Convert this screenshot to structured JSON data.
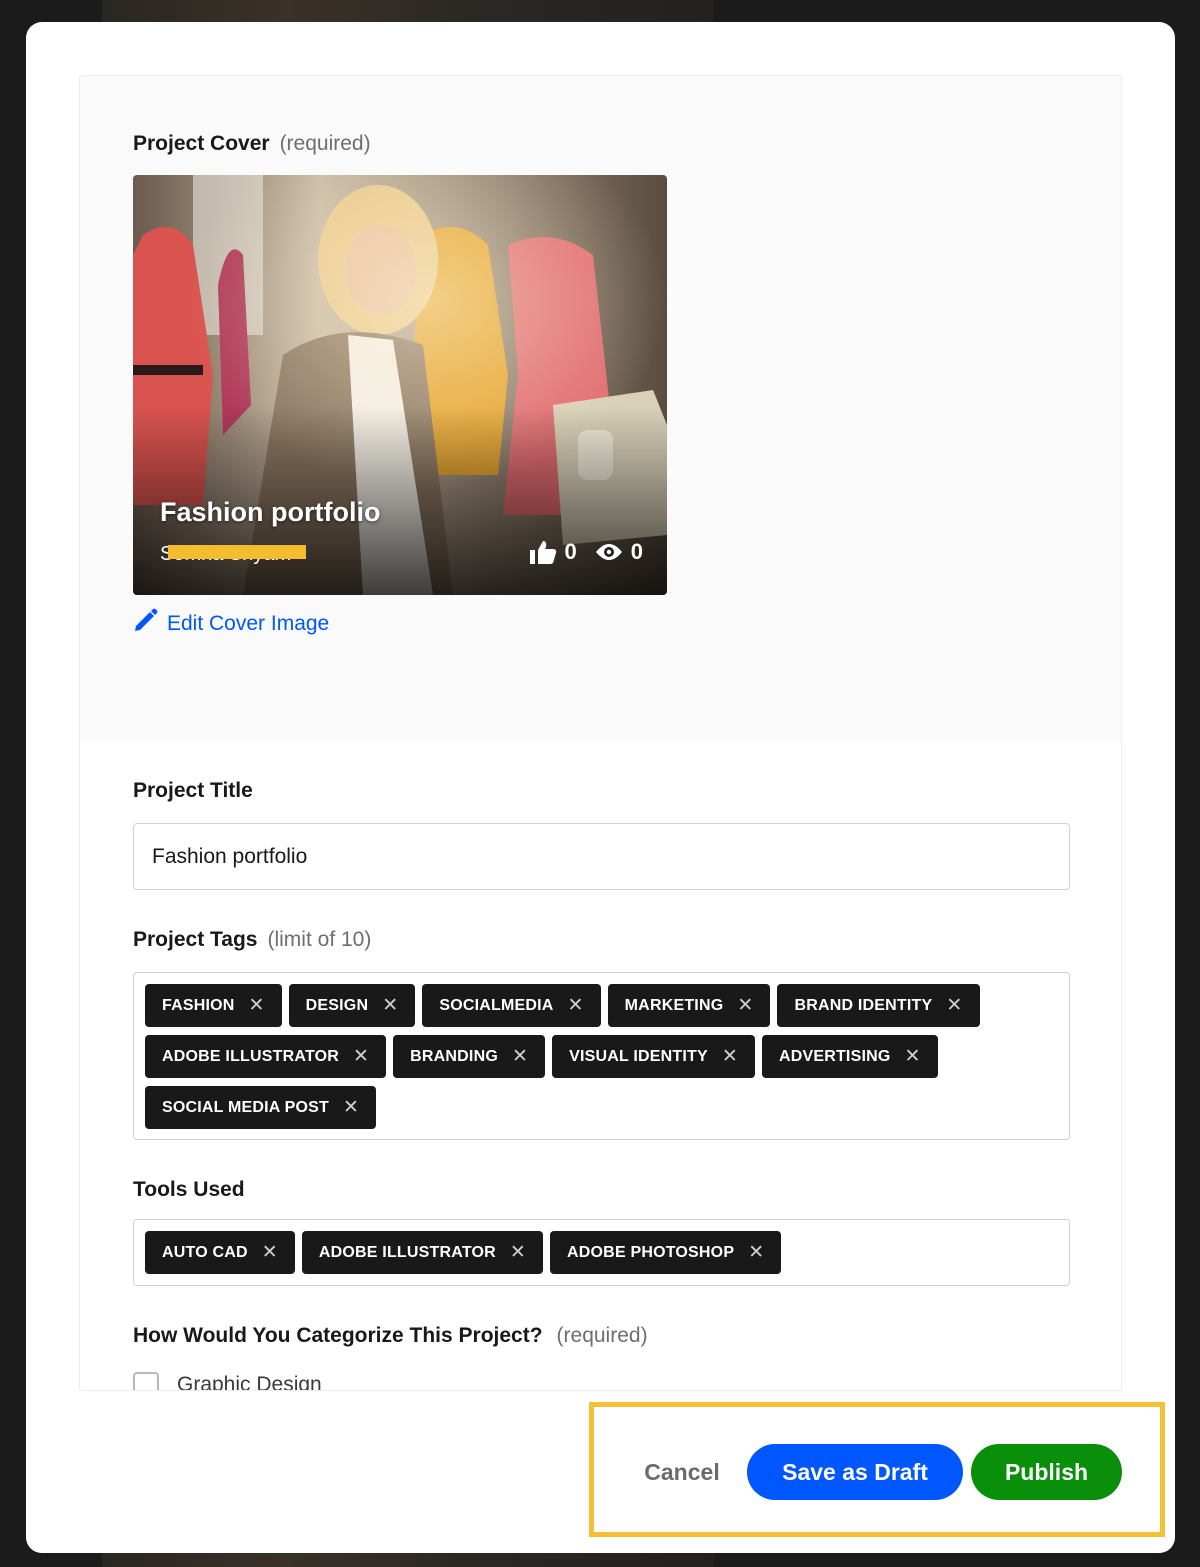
{
  "cover": {
    "label": "Project Cover",
    "hint": "(required)",
    "card_title": "Fashion portfolio",
    "owner_name": "Somna Shyam",
    "likes": "0",
    "views": "0",
    "edit_label": "Edit Cover Image"
  },
  "title": {
    "label": "Project Title",
    "value": "Fashion portfolio"
  },
  "tags": {
    "label": "Project Tags",
    "hint": "(limit of 10)",
    "items": [
      "FASHION",
      "DESIGN",
      "SOCIALMEDIA",
      "MARKETING",
      "BRAND IDENTITY",
      "ADOBE ILLUSTRATOR",
      "BRANDING",
      "VISUAL IDENTITY",
      "ADVERTISING",
      "SOCIAL MEDIA POST"
    ]
  },
  "tools": {
    "label": "Tools Used",
    "items": [
      "AUTO CAD",
      "ADOBE ILLUSTRATOR",
      "ADOBE PHOTOSHOP"
    ]
  },
  "category": {
    "label": "How Would You Categorize This Project?",
    "hint": "(required)",
    "options": [
      {
        "label": "Graphic Design",
        "checked": false
      }
    ]
  },
  "footer": {
    "cancel_label": "Cancel",
    "draft_label": "Save as Draft",
    "publish_label": "Publish"
  },
  "remove_glyph": "✕",
  "colors": {
    "primary_blue": "#0057ff",
    "publish_green": "#0a8f0a",
    "tag_bg": "#191919",
    "highlight": "#f5c035"
  }
}
